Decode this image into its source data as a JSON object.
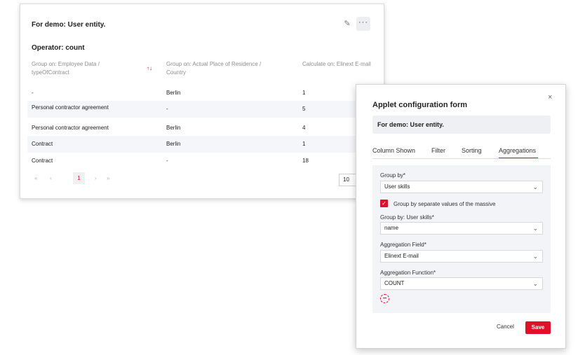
{
  "card": {
    "title": "For demo: User entity.",
    "operator": "Operator: count",
    "edit_icon": "pencil-icon",
    "more_icon": "more-icon",
    "columns": [
      {
        "label": "Group on: Employee Data / typeOfContract"
      },
      {
        "label": "Group on: Actual Place of Residence / Country"
      },
      {
        "label": "Calculate on: Elinext E-mail"
      }
    ],
    "rows": [
      [
        "-",
        "Berlin",
        "1"
      ],
      [
        "Personal contractor agreement",
        "-",
        "5"
      ],
      [
        "Personal contractor agreement",
        "Berlin",
        "4"
      ],
      [
        "Contract",
        "Berlin",
        "1"
      ],
      [
        "Contract",
        "-",
        "18"
      ]
    ],
    "pager": {
      "first": "«",
      "prev": "‹",
      "current_page": "1",
      "next": "›",
      "last": "»",
      "page_size": "10"
    }
  },
  "modal": {
    "close": "×",
    "title": "Applet configuration form",
    "entity_name": "For demo: User entity.",
    "tabs": [
      "Column Shown",
      "Filter",
      "Sorting",
      "Aggregations"
    ],
    "active_tab": "Aggregations",
    "group_by_label": "Group by*",
    "group_by_value": "User skills",
    "checkbox_checked": true,
    "checkbox_label": "Group by separate values of the massive",
    "group_by_sub_label": "Group by: User skills*",
    "group_by_sub_value": "name",
    "agg_field_label": "Aggregation Field*",
    "agg_field_value": "Elinext E-mail",
    "agg_function_label": "Aggregation Function*",
    "agg_function_value": "COUNT",
    "cancel_label": "Cancel",
    "save_label": "Save"
  },
  "colors": {
    "accent": "#e0102b",
    "panel": "#f2f4f7"
  }
}
